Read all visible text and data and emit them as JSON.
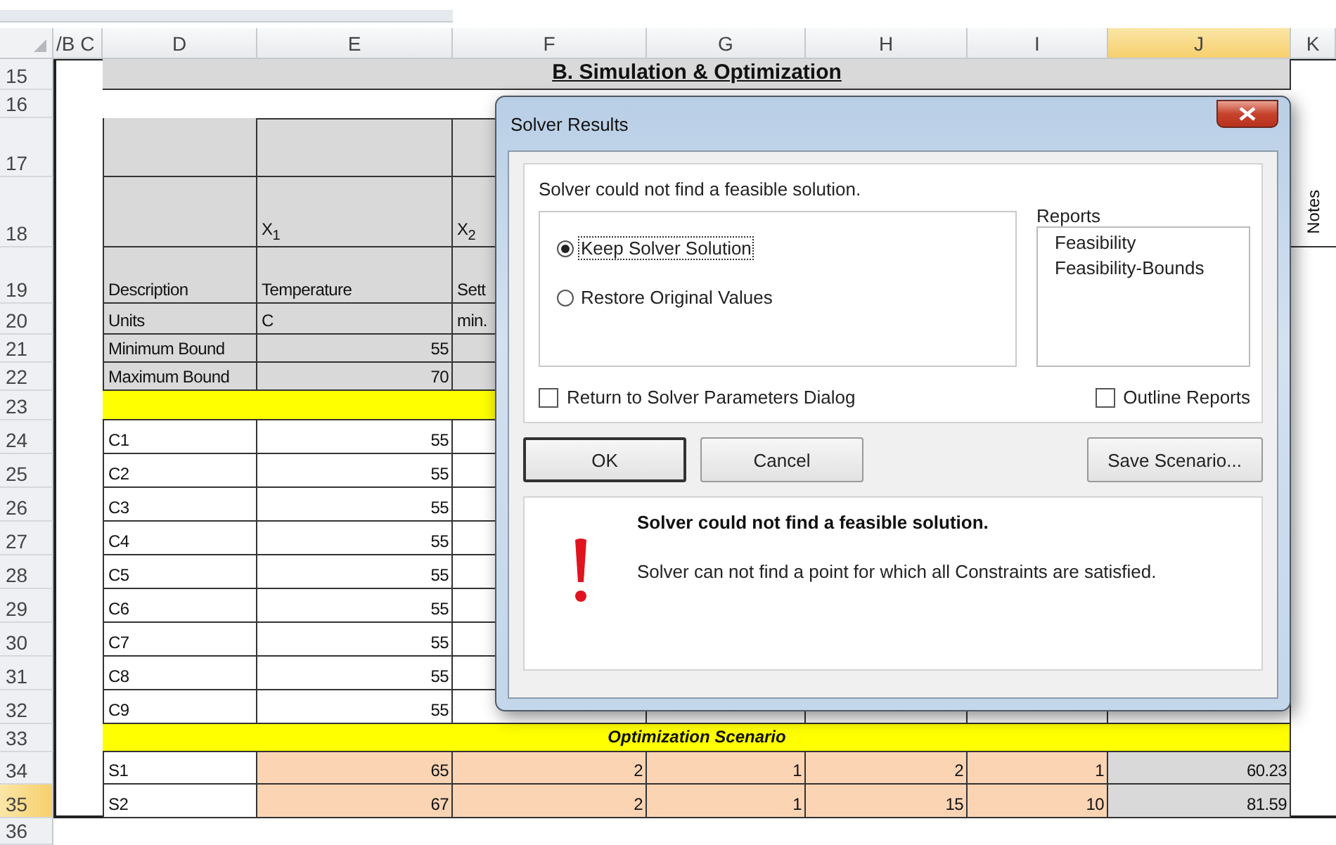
{
  "sheet": {
    "columns": [
      {
        "label": "/B C",
        "selected": false
      },
      {
        "label": "D",
        "selected": false
      },
      {
        "label": "E",
        "selected": false
      },
      {
        "label": "F",
        "selected": false
      },
      {
        "label": "G",
        "selected": false
      },
      {
        "label": "H",
        "selected": false
      },
      {
        "label": "I",
        "selected": false
      },
      {
        "label": "J",
        "selected": true
      },
      {
        "label": "K",
        "selected": false
      }
    ],
    "rows": [
      {
        "number": "15",
        "selected": false,
        "kind": "title",
        "D": "B. Simulation & Optimization"
      },
      {
        "number": "16",
        "selected": false,
        "kind": "blank"
      },
      {
        "number": "17",
        "selected": false,
        "kind": "head"
      },
      {
        "number": "18",
        "selected": false,
        "kind": "head",
        "E": "X$_{1}$",
        "F": "X$_{2}$",
        "K": "Notes"
      },
      {
        "number": "19",
        "selected": false,
        "kind": "head",
        "D": "Description",
        "E": "Temperature",
        "F": "Sett"
      },
      {
        "number": "20",
        "selected": false,
        "kind": "units",
        "D": "Units",
        "E": "C",
        "F": "min."
      },
      {
        "number": "21",
        "selected": false,
        "kind": "bounds",
        "D": "Minimum Bound",
        "E": "55"
      },
      {
        "number": "22",
        "selected": false,
        "kind": "bounds",
        "D": "Maximum Bound",
        "E": "70"
      },
      {
        "number": "23",
        "selected": false,
        "kind": "band"
      },
      {
        "number": "24",
        "selected": false,
        "kind": "data",
        "D": "C1",
        "E": "55"
      },
      {
        "number": "25",
        "selected": false,
        "kind": "data",
        "D": "C2",
        "E": "55"
      },
      {
        "number": "26",
        "selected": false,
        "kind": "data",
        "D": "C3",
        "E": "55"
      },
      {
        "number": "27",
        "selected": false,
        "kind": "data",
        "D": "C4",
        "E": "55"
      },
      {
        "number": "28",
        "selected": false,
        "kind": "data",
        "D": "C5",
        "E": "55"
      },
      {
        "number": "29",
        "selected": false,
        "kind": "data",
        "D": "C6",
        "E": "55"
      },
      {
        "number": "30",
        "selected": false,
        "kind": "data",
        "D": "C7",
        "E": "55"
      },
      {
        "number": "31",
        "selected": false,
        "kind": "data",
        "D": "C8",
        "E": "55"
      },
      {
        "number": "32",
        "selected": false,
        "kind": "data",
        "D": "C9",
        "E": "55"
      },
      {
        "number": "33",
        "selected": false,
        "kind": "band",
        "D": "Optimization Scenario"
      },
      {
        "number": "34",
        "selected": false,
        "kind": "scenario",
        "D": "S1",
        "E": "65",
        "F": "2",
        "G": "1",
        "H": "2",
        "I": "1",
        "J": "60.23"
      },
      {
        "number": "35",
        "selected": true,
        "kind": "scenario",
        "D": "S2",
        "E": "67",
        "F": "2",
        "G": "1",
        "H": "15",
        "I": "10",
        "J": "81.59"
      },
      {
        "number": "36",
        "selected": false,
        "kind": "blank"
      }
    ]
  },
  "dialog": {
    "title": "Solver Results",
    "message": "Solver could not find a feasible solution.",
    "options": [
      {
        "label": "Keep Solver Solution",
        "selected": true,
        "focused": true
      },
      {
        "label": "Restore Original Values",
        "selected": false,
        "focused": false
      }
    ],
    "reports_label": "Reports",
    "reports": [
      "Feasibility",
      "Feasibility-Bounds"
    ],
    "checkboxes": [
      {
        "label": "Return to Solver Parameters Dialog",
        "checked": false
      },
      {
        "label": "Outline Reports",
        "checked": false
      }
    ],
    "buttons": [
      {
        "label": "OK",
        "default": true
      },
      {
        "label": "Cancel",
        "default": false
      },
      {
        "label": "Save Scenario...",
        "default": false
      }
    ],
    "detail_title": "Solver could not find a feasible solution.",
    "detail_text": "Solver can not find a point for which all Constraints are satisfied."
  }
}
